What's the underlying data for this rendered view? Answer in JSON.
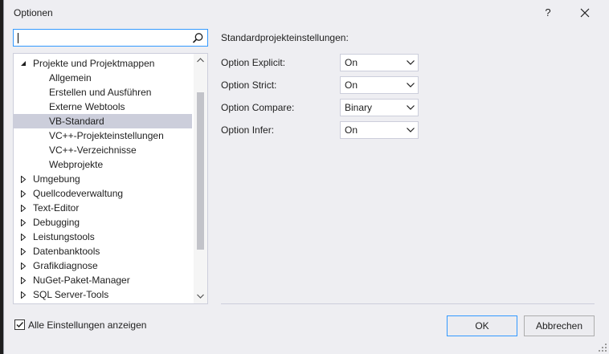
{
  "dialog": {
    "title": "Optionen",
    "help_label": "?"
  },
  "search": {
    "value": "",
    "placeholder": ""
  },
  "tree": {
    "items": [
      {
        "label": "Projekte und Projektmappen",
        "level": 0,
        "state": "expanded"
      },
      {
        "label": "Allgemein",
        "level": 1
      },
      {
        "label": "Erstellen und Ausführen",
        "level": 1
      },
      {
        "label": "Externe Webtools",
        "level": 1
      },
      {
        "label": "VB-Standard",
        "level": 1,
        "selected": true
      },
      {
        "label": "VC++-Projekteinstellungen",
        "level": 1
      },
      {
        "label": "VC++-Verzeichnisse",
        "level": 1
      },
      {
        "label": "Webprojekte",
        "level": 1
      },
      {
        "label": "Umgebung",
        "level": 0,
        "state": "collapsed"
      },
      {
        "label": "Quellcodeverwaltung",
        "level": 0,
        "state": "collapsed"
      },
      {
        "label": "Text-Editor",
        "level": 0,
        "state": "collapsed"
      },
      {
        "label": "Debugging",
        "level": 0,
        "state": "collapsed"
      },
      {
        "label": "Leistungstools",
        "level": 0,
        "state": "collapsed"
      },
      {
        "label": "Datenbanktools",
        "level": 0,
        "state": "collapsed"
      },
      {
        "label": "Grafikdiagnose",
        "level": 0,
        "state": "collapsed"
      },
      {
        "label": "NuGet-Paket-Manager",
        "level": 0,
        "state": "collapsed"
      },
      {
        "label": "SQL Server-Tools",
        "level": 0,
        "state": "collapsed"
      }
    ]
  },
  "settings": {
    "section_title": "Standardprojekteinstellungen:",
    "options": [
      {
        "label": "Option Explicit:",
        "value": "On"
      },
      {
        "label": "Option Strict:",
        "value": "On"
      },
      {
        "label": "Option Compare:",
        "value": "Binary"
      },
      {
        "label": "Option Infer:",
        "value": "On"
      }
    ]
  },
  "footer": {
    "show_all_label": "Alle Einstellungen anzeigen",
    "show_all_checked": true,
    "ok_label": "OK",
    "cancel_label": "Abbrechen"
  },
  "colors": {
    "accent": "#3399ff",
    "dialog_bg": "#eeeef2",
    "selection": "#cccedb"
  }
}
